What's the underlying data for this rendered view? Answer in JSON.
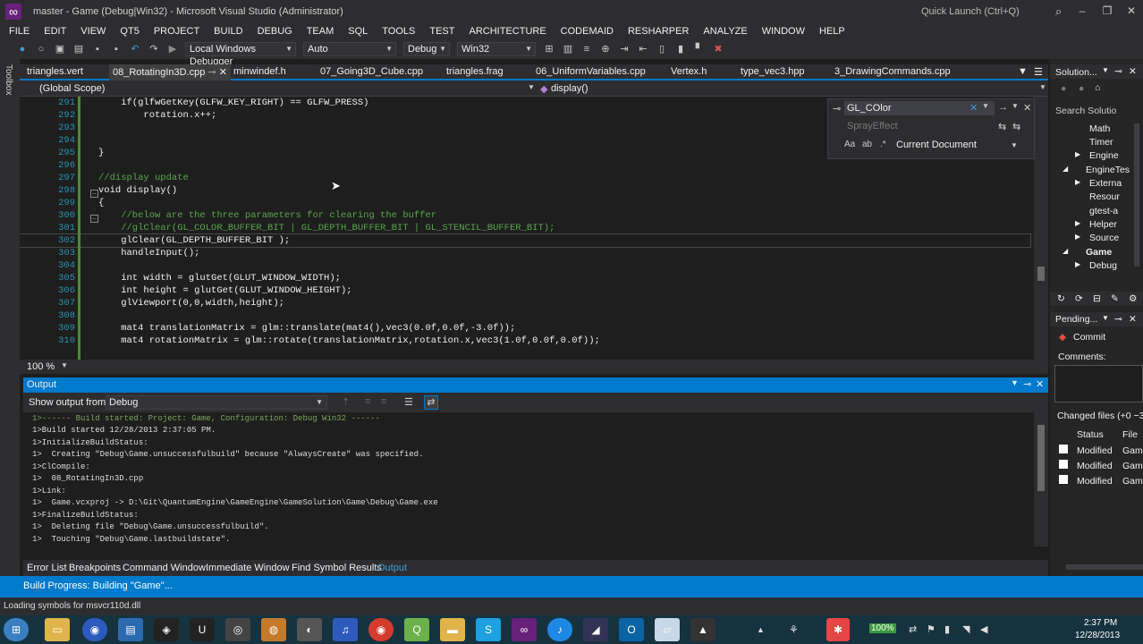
{
  "window": {
    "title": "master - Game (Debug|Win32) - Microsoft Visual Studio (Administrator)",
    "quick_launch": "Quick Launch (Ctrl+Q)"
  },
  "menu": [
    "FILE",
    "EDIT",
    "VIEW",
    "QT5",
    "PROJECT",
    "BUILD",
    "DEBUG",
    "TEAM",
    "SQL",
    "TOOLS",
    "TEST",
    "ARCHITECTURE",
    "CODEMAID",
    "RESHARPER",
    "ANALYZE",
    "WINDOW",
    "HELP"
  ],
  "toolbar": {
    "debugger": "Local Windows Debugger",
    "mode": "Auto",
    "config": "Debug",
    "platform": "Win32"
  },
  "toolbox": "Toolbox",
  "tabs": [
    "triangles.vert",
    "08_RotatingIn3D.cpp",
    "minwindef.h",
    "07_Going3D_Cube.cpp",
    "triangles.frag",
    "06_UniformVariables.cpp",
    "Vertex.h",
    "type_vec3.hpp",
    "3_DrawingCommands.cpp"
  ],
  "nav": {
    "scope": "(Global Scope)",
    "member": "display()"
  },
  "find": {
    "value": "GL_COlor",
    "replace_placeholder": "SprayEffect",
    "scope": "Current Document"
  },
  "code": [
    {
      "n": "291",
      "t": "    if(glfwGetKey(GLFW_KEY_RIGHT) == GLFW_PRESS)"
    },
    {
      "n": "292",
      "t": "        rotation.x++;"
    },
    {
      "n": "293",
      "t": ""
    },
    {
      "n": "294",
      "t": ""
    },
    {
      "n": "295",
      "t": "}"
    },
    {
      "n": "296",
      "t": ""
    },
    {
      "n": "297",
      "t": "//display update"
    },
    {
      "n": "298",
      "t": "void display()"
    },
    {
      "n": "299",
      "t": "{"
    },
    {
      "n": "300",
      "t": "    //below are the three parameters for clearing the buffer"
    },
    {
      "n": "301",
      "t": "    //glClear(GL_COLOR_BUFFER_BIT | GL_DEPTH_BUFFER_BIT | GL_STENCIL_BUFFER_BIT);"
    },
    {
      "n": "302",
      "t": "    glClear(GL_DEPTH_BUFFER_BIT );"
    },
    {
      "n": "303",
      "t": "    handleInput();"
    },
    {
      "n": "304",
      "t": ""
    },
    {
      "n": "305",
      "t": "    int width = glutGet(GLUT_WINDOW_WIDTH);"
    },
    {
      "n": "306",
      "t": "    int height = glutGet(GLUT_WINDOW_HEIGHT);"
    },
    {
      "n": "307",
      "t": "    glViewport(0,0,width,height);"
    },
    {
      "n": "308",
      "t": ""
    },
    {
      "n": "309",
      "t": "    mat4 translationMatrix = glm::translate(mat4(),vec3(0.0f,0.0f,-3.0f));"
    },
    {
      "n": "310",
      "t": "    mat4 rotationMatrix = glm::rotate(translationMatrix,rotation.x,vec3(1.0f,0.0f,0.0f));"
    }
  ],
  "zoom": "100 %",
  "output": {
    "title": "Output",
    "show_from_label": "Show output from:",
    "source": "Debug",
    "lines": [
      "1>------ Build started: Project: Game, Configuration: Debug Win32 ------",
      "1>Build started 12/28/2013 2:37:05 PM.",
      "1>InitializeBuildStatus:",
      "1>  Creating \"Debug\\Game.unsuccessfulbuild\" because \"AlwaysCreate\" was specified.",
      "1>ClCompile:",
      "1>  08_RotatingIn3D.cpp",
      "1>Link:",
      "1>  Game.vcxproj -> D:\\Git\\QuantumEngine\\GameEngine\\GameSolution\\Game\\Debug\\Game.exe",
      "1>FinalizeBuildStatus:",
      "1>  Deleting file \"Debug\\Game.unsuccessfulbuild\".",
      "1>  Touching \"Debug\\Game.lastbuildstate\"."
    ]
  },
  "bottom_tabs": [
    "Error List",
    "Breakpoints",
    "Command Window",
    "Immediate Window",
    "Find Symbol Results",
    "Output"
  ],
  "status": "Build Progress: Building \"Game\"...",
  "win_status": "Loading symbols for msvcr110d.dll",
  "solution": {
    "title": "Solution...",
    "search": "Search Solutio",
    "items": [
      "Math",
      "Timer",
      "Engine",
      "EngineTes",
      "Externa",
      "Resour",
      "gtest-a",
      "Helper",
      "Source",
      "Game",
      "Debug"
    ]
  },
  "pending": {
    "title": "Pending...",
    "commit": "Commit",
    "comments": "Comments:",
    "changed": "Changed files (+0 −3",
    "col_status": "Status",
    "col_file": "File",
    "rows": [
      {
        "s": "Modified",
        "f": "Gam"
      },
      {
        "s": "Modified",
        "f": "Gam"
      },
      {
        "s": "Modified",
        "f": "Gam"
      }
    ]
  },
  "clock": {
    "time": "2:37 PM",
    "date": "12/28/2013"
  },
  "battery": "100%"
}
